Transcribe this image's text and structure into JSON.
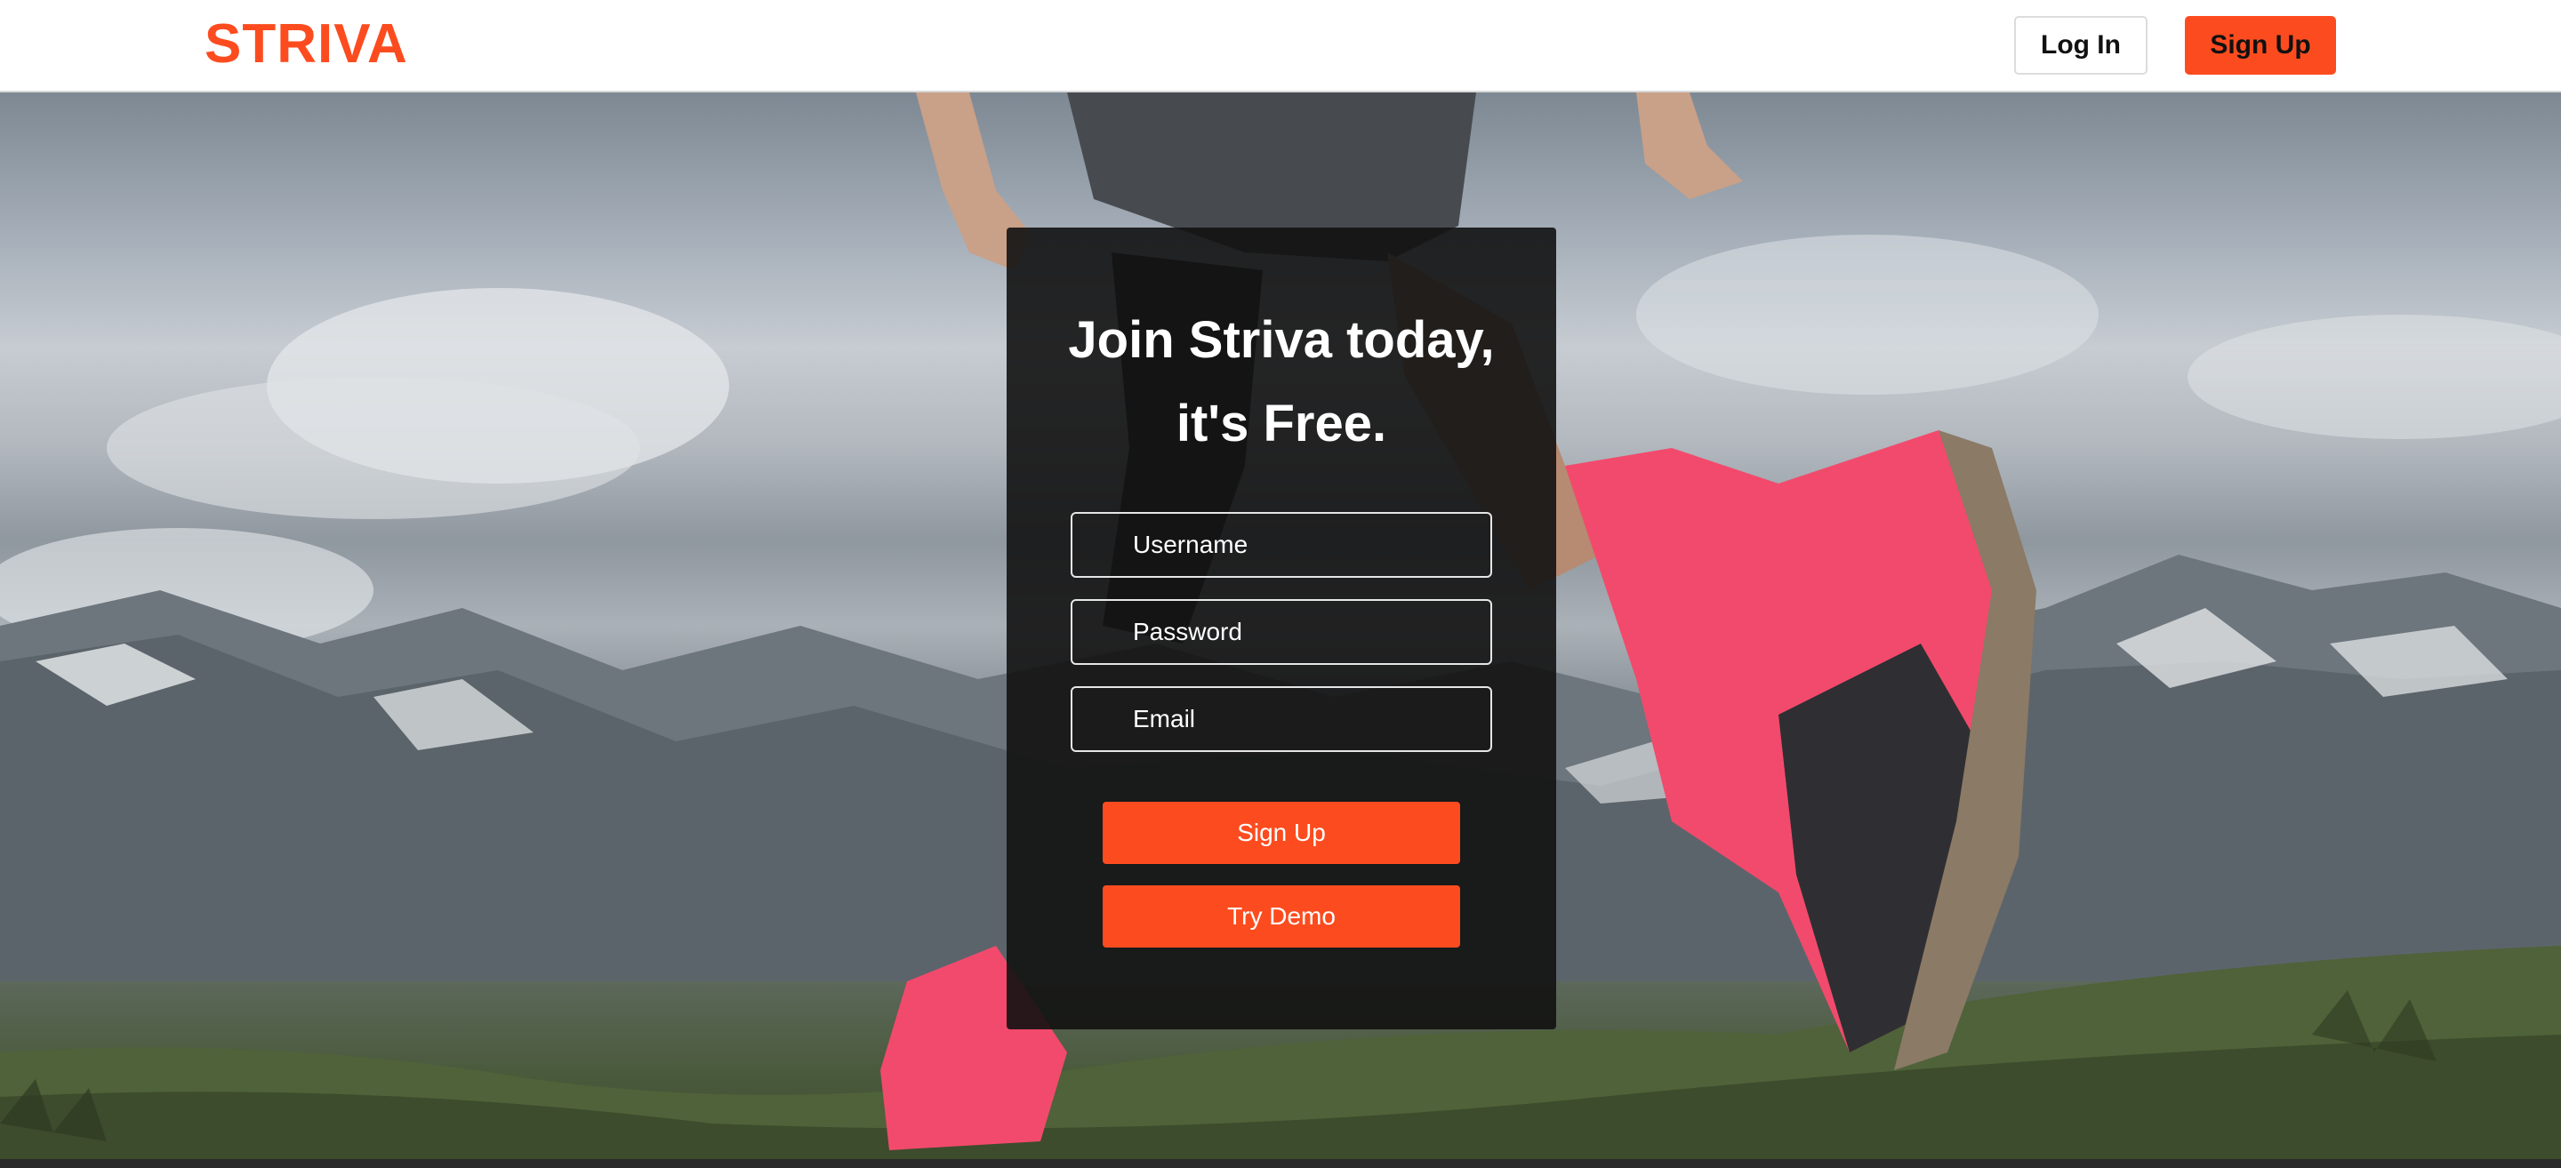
{
  "navbar": {
    "logo": "STRIVA",
    "login_label": "Log In",
    "signup_label": "Sign Up"
  },
  "hero": {
    "image_description": "runner-on-mountain-background"
  },
  "signup_card": {
    "title_line1": "Join Striva today,",
    "title_line2": "it's Free.",
    "username_placeholder": "Username",
    "password_placeholder": "Password",
    "email_placeholder": "Email",
    "signup_button": "Sign Up",
    "demo_button": "Try Demo"
  },
  "colors": {
    "brand": "#fc4c1f",
    "card_background": "#121212",
    "nav_background": "#ffffff"
  }
}
